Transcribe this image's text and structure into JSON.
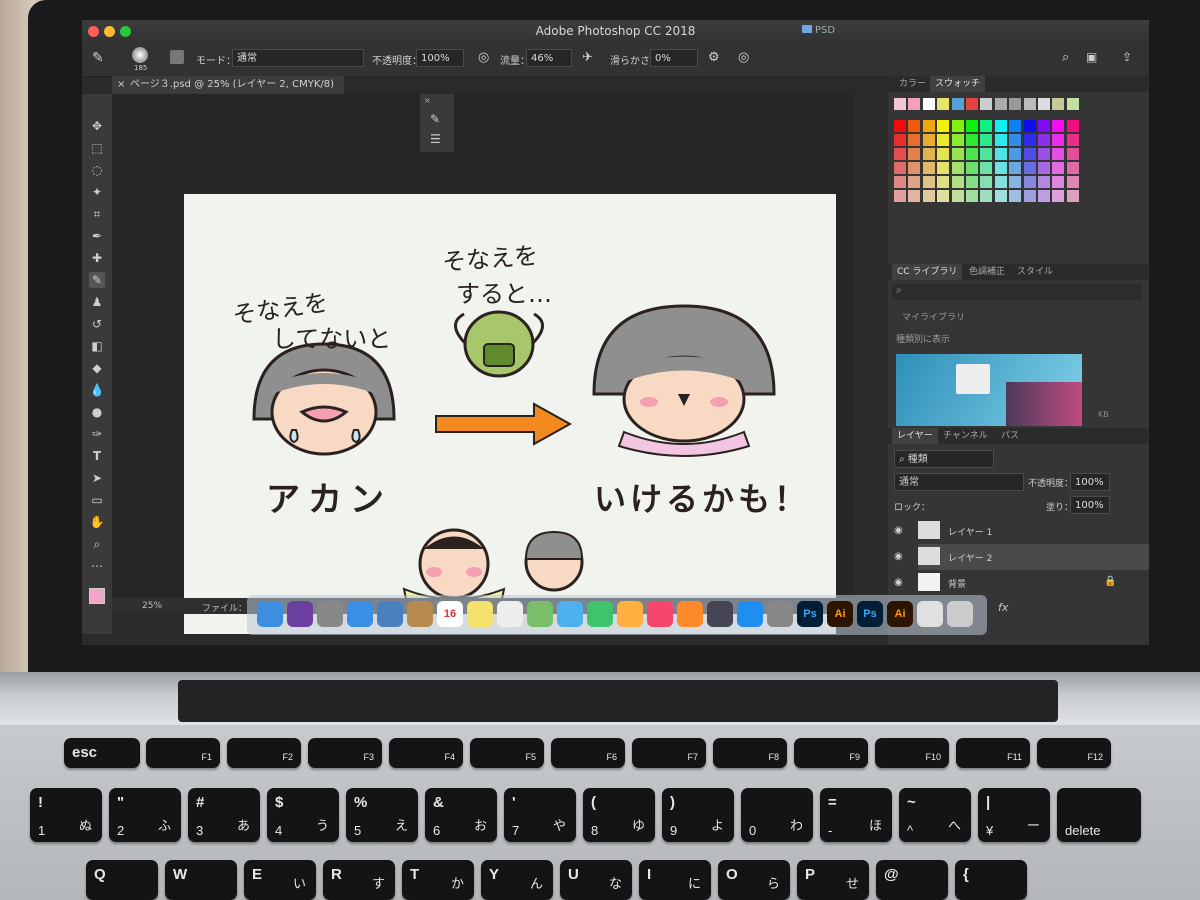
{
  "app": {
    "window_title": "Adobe Photoshop CC 2018",
    "background_window_title": "PSD"
  },
  "options_bar": {
    "brush_size": "185",
    "mode_label": "モード：",
    "mode_value": "通常",
    "opacity_label": "不透明度：",
    "opacity_value": "100%",
    "flow_label": "流量：",
    "flow_value": "46%",
    "smoothing_label": "滑らかさ：",
    "smoothing_value": "0%"
  },
  "document": {
    "tab_label": "ページ３.psd @ 25% (レイヤー 2, CMYK/8)",
    "zoom": "25%",
    "file_label": "ファイル："
  },
  "artwork": {
    "caption_left": [
      "そなえを",
      "してないと"
    ],
    "caption_center": [
      "そなえを",
      "すると…"
    ],
    "word_left": "アカン",
    "word_right": "いけるかも！"
  },
  "panels": {
    "color_tabs": [
      "カラー",
      "スウォッチ"
    ],
    "library_tabs": [
      "CC ライブラリ",
      "色調補正",
      "スタイル"
    ],
    "library_name": "マイライブラリ",
    "library_view": "種類別に表示",
    "library_size": "KB",
    "layer_tabs": [
      "レイヤー",
      "チャンネル",
      "パス"
    ],
    "layer_filter": "種類",
    "blend_mode": "通常",
    "layer_opacity_label": "不透明度：",
    "layer_opacity": "100%",
    "lock_label": "ロック：",
    "fill_label": "塗り：",
    "fill_value": "100%",
    "layers": [
      "レイヤー 1",
      "レイヤー 2",
      "背景"
    ],
    "footer": "fx"
  },
  "dock": {
    "icons": [
      "Finder",
      "Siri",
      "Launchpad",
      "Safari",
      "Preview",
      "Contacts",
      "Calendar",
      "Notes",
      "TextEdit",
      "Maps",
      "Messages",
      "FaceTime",
      "Photos",
      "Music",
      "Books",
      "Time Machine",
      "App Store",
      "System Preferences",
      "Ps",
      "Ai",
      "Ps",
      "Ai",
      "Chrome",
      "Trash"
    ],
    "calendar_day": "16"
  },
  "keyboard": {
    "row_fn": [
      "esc",
      "F1",
      "F2",
      "F3",
      "F4",
      "F5",
      "F6",
      "F7",
      "F8",
      "F9",
      "F10",
      "F11",
      "F12"
    ],
    "row_num": [
      {
        "top": "!",
        "main": "1",
        "kana": "ぬ"
      },
      {
        "top": "\"",
        "main": "2",
        "kana": "ふ"
      },
      {
        "top": "#",
        "main": "3",
        "kana": "あ"
      },
      {
        "top": "$",
        "main": "4",
        "kana": "う"
      },
      {
        "top": "%",
        "main": "5",
        "kana": "え"
      },
      {
        "top": "&",
        "main": "6",
        "kana": "お"
      },
      {
        "top": "'",
        "main": "7",
        "kana": "や"
      },
      {
        "top": "(",
        "main": "8",
        "kana": "ゆ"
      },
      {
        "top": ")",
        "main": "9",
        "kana": "よ"
      },
      {
        "top": "",
        "main": "0",
        "kana": "わ"
      },
      {
        "top": "=",
        "main": "-",
        "kana": "ほ"
      },
      {
        "top": "~",
        "main": "^",
        "kana": "へ"
      },
      {
        "top": "|",
        "main": "¥",
        "kana": "ー"
      },
      {
        "top": "",
        "main": "delete",
        "kana": ""
      }
    ],
    "row_q": [
      {
        "main": "Q",
        "kana": ""
      },
      {
        "main": "W",
        "kana": ""
      },
      {
        "main": "E",
        "kana": "い"
      },
      {
        "main": "R",
        "kana": "す"
      },
      {
        "main": "T",
        "kana": "か"
      },
      {
        "main": "Y",
        "kana": "ん"
      },
      {
        "main": "U",
        "kana": "な"
      },
      {
        "main": "I",
        "kana": "に"
      },
      {
        "main": "O",
        "kana": "ら"
      },
      {
        "main": "P",
        "kana": "せ"
      },
      {
        "main": "@",
        "kana": ""
      },
      {
        "main": "{",
        "kana": ""
      }
    ]
  }
}
